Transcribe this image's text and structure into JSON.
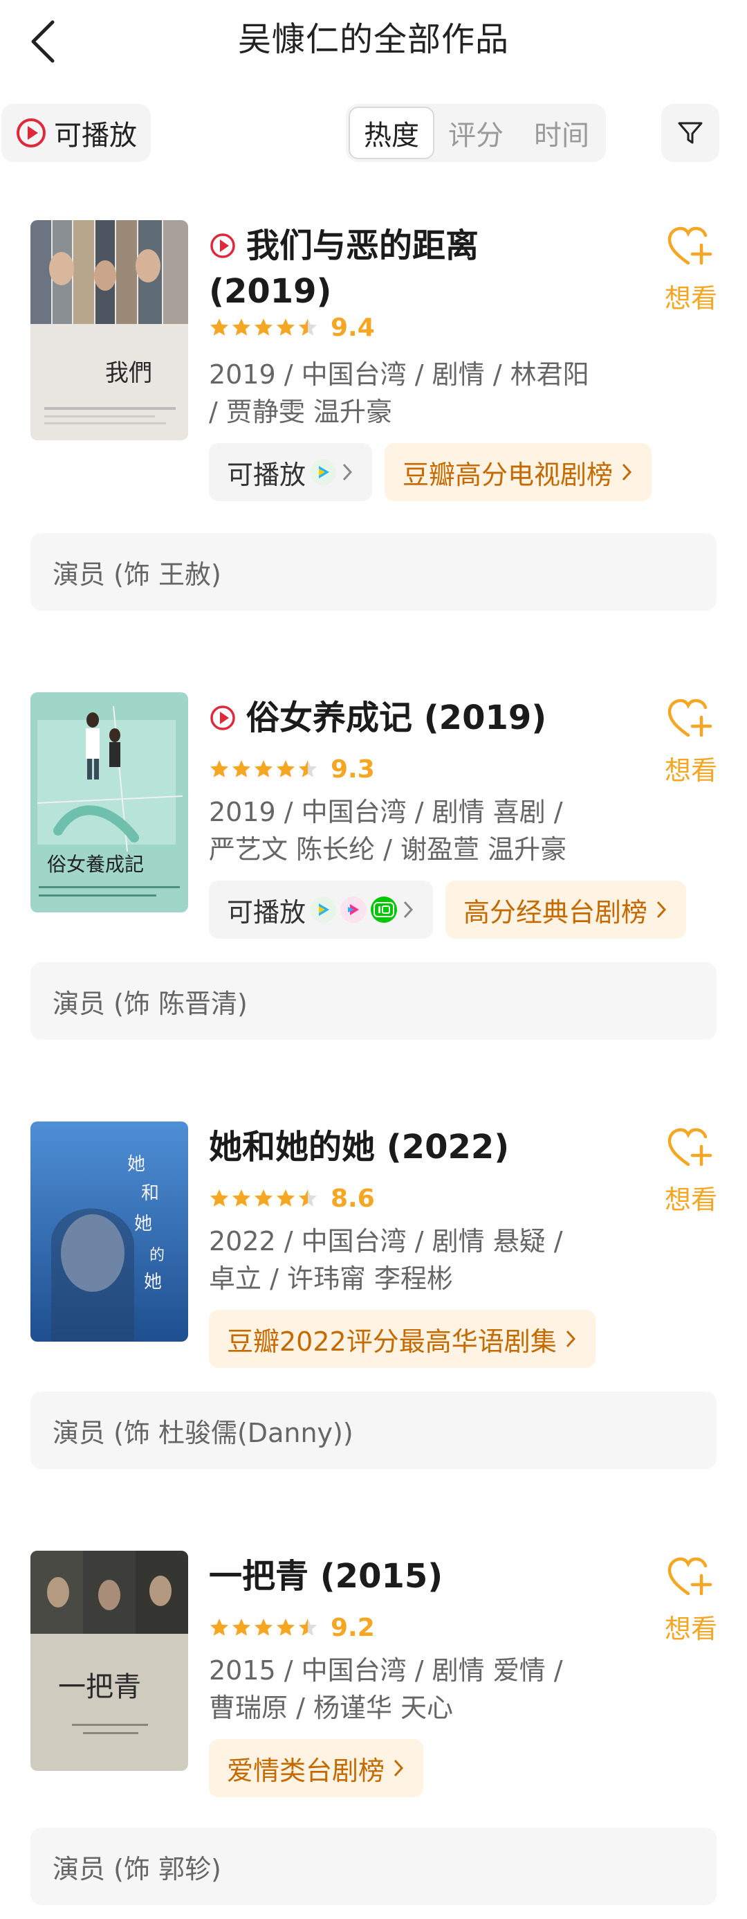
{
  "header": {
    "title": "吴慷仁的全部作品",
    "back_icon": "chevron-left-icon"
  },
  "filters": {
    "playable_label": "可播放",
    "sort_tabs": [
      "热度",
      "评分",
      "时间"
    ],
    "active_sort": "热度",
    "filter_icon": "funnel-icon"
  },
  "colors": {
    "accent_orange": "#f5a623",
    "rank_text": "#c46a00",
    "rank_bg": "#fff4e3",
    "play_red": "#e0283c"
  },
  "works": [
    {
      "title": "我们与恶的距离",
      "year": "(2019)",
      "playable": true,
      "rating": "9.4",
      "stars": 4.5,
      "meta": "2019 / 中国台湾 / 剧情 / 林君阳 / 贾静雯 温升豪",
      "play_label": "可播放",
      "platforms": [
        "tencent"
      ],
      "rank_tag": "豆瓣高分电视剧榜",
      "want_label": "想看",
      "role": "演员 (饰 王赦)"
    },
    {
      "title": "俗女养成记",
      "year": "(2019)",
      "playable": true,
      "rating": "9.3",
      "stars": 4.5,
      "meta": "2019 / 中国台湾 / 剧情 喜剧 / 严艺文 陈长纶 / 谢盈萱 温升豪",
      "play_label": "可播放",
      "platforms": [
        "tencent",
        "youku",
        "iqiyi"
      ],
      "rank_tag": "高分经典台剧榜",
      "want_label": "想看",
      "role": "演员 (饰 陈晋清)"
    },
    {
      "title": "她和她的她",
      "year": "(2022)",
      "playable": false,
      "rating": "8.6",
      "stars": 4.5,
      "meta": "2022 / 中国台湾 / 剧情 悬疑 / 卓立 / 许玮甯 李程彬",
      "rank_tag": "豆瓣2022评分最高华语剧集",
      "want_label": "想看",
      "role": "演员 (饰 杜骏儒(Danny))"
    },
    {
      "title": "一把青",
      "year": "(2015)",
      "playable": false,
      "rating": "9.2",
      "stars": 4.5,
      "meta": "2015 / 中国台湾 / 剧情 爱情 / 曹瑞原 / 杨谨华 天心",
      "rank_tag": "爱情类台剧榜",
      "want_label": "想看",
      "role": "演员 (饰 郭轸)"
    }
  ]
}
